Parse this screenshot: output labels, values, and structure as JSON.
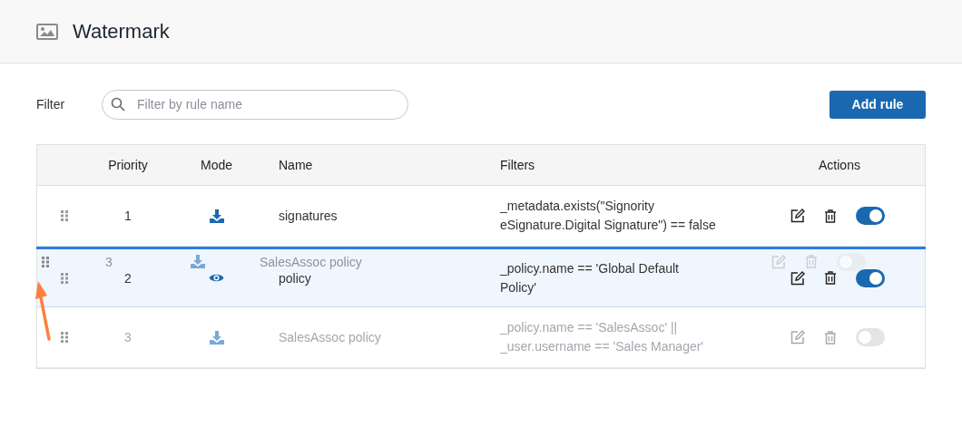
{
  "page": {
    "title": "Watermark"
  },
  "filter": {
    "label": "Filter",
    "placeholder": "Filter by rule name"
  },
  "add_button": "Add rule",
  "table": {
    "columns": [
      "Priority",
      "Mode",
      "Name",
      "Filters",
      "Actions"
    ],
    "rows": [
      {
        "priority": "1",
        "kind": "download",
        "name": "signatures",
        "filters": "_metadata.exists(\"Signority\neSignature.Digital Signature\") == false",
        "enabled": true,
        "selected": false
      },
      {
        "priority": "2",
        "kind": "view",
        "name": "policy",
        "filters": "_policy.name == 'Global Default\nPolicy'",
        "enabled": true,
        "selected": true
      },
      {
        "priority": "3",
        "kind": "download",
        "name": "SalesAssoc policy",
        "filters": "_policy.name == 'SalesAssoc' ||\n_user.username == 'Sales Manager'",
        "enabled": false,
        "selected": false
      }
    ],
    "drag_ghost": {
      "priority": "3",
      "kind": "download",
      "name": "SalesAssoc policy",
      "enabled": false
    }
  }
}
